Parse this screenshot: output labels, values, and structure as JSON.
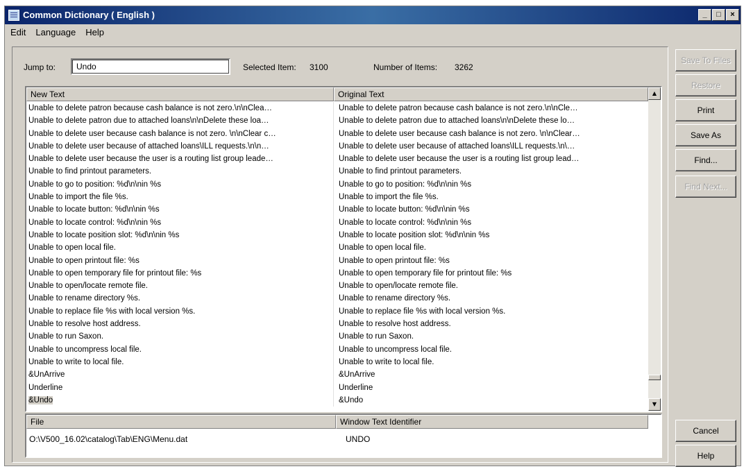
{
  "window": {
    "title": "Common Dictionary  ( English )",
    "controls": {
      "minimize": "_",
      "maximize": "□",
      "close": "×"
    }
  },
  "menu": {
    "items": [
      "Edit",
      "Language",
      "Help"
    ]
  },
  "toolbar": {
    "jump_label": "Jump to:",
    "jump_value": "Undo",
    "selected_item_label": "Selected Item:",
    "selected_item_value": "3100",
    "number_items_label": "Number of Items:",
    "number_items_value": "3262"
  },
  "main_table": {
    "headers": [
      "New Text",
      "Original Text"
    ],
    "rows": [
      [
        "Unable to delete patron because cash balance is not zero.\\n\\nClea…",
        "Unable to delete patron because cash balance is not zero.\\n\\nCle…"
      ],
      [
        "Unable to delete patron due to attached loans\\n\\nDelete these loa…",
        "Unable to delete patron due to attached loans\\n\\nDelete these lo…"
      ],
      [
        "Unable to delete user because cash balance is not zero. \\n\\nClear c…",
        "Unable to delete user because cash balance is not zero. \\n\\nClear…"
      ],
      [
        "Unable to delete user because of attached loans\\ILL requests.\\n\\n…",
        "Unable to delete user because of attached loans\\ILL requests.\\n\\…"
      ],
      [
        "Unable to delete user because the user is a routing list group leade…",
        "Unable to delete user because the user is a routing list group lead…"
      ],
      [
        "Unable to find printout parameters.",
        "Unable to find printout parameters."
      ],
      [
        "Unable to go to position: %d\\n\\nin %s",
        "Unable to go to position: %d\\n\\nin %s"
      ],
      [
        "Unable to import the file %s.",
        "Unable to import the file %s."
      ],
      [
        "Unable to locate button: %d\\n\\nin %s",
        "Unable to locate button: %d\\n\\nin %s"
      ],
      [
        "Unable to locate control: %d\\n\\nin %s",
        "Unable to locate control: %d\\n\\nin %s"
      ],
      [
        "Unable to locate position slot: %d\\n\\nin %s",
        "Unable to locate position slot: %d\\n\\nin %s"
      ],
      [
        "Unable to open local file.",
        "Unable to open local file."
      ],
      [
        "Unable to open printout file: %s",
        "Unable to open printout file: %s"
      ],
      [
        "Unable to open temporary file for printout file: %s",
        "Unable to open temporary file for printout file: %s"
      ],
      [
        "Unable to open/locate remote file.",
        "Unable to open/locate remote file."
      ],
      [
        "Unable to rename directory %s.",
        "Unable to rename directory %s."
      ],
      [
        "Unable to replace file %s with local version %s.",
        "Unable to replace file %s with local version %s."
      ],
      [
        "Unable to resolve host address.",
        "Unable to resolve host address."
      ],
      [
        "Unable to run Saxon.",
        "Unable to run Saxon."
      ],
      [
        "Unable to uncompress local file.",
        "Unable to uncompress local file."
      ],
      [
        "Unable to write to local file.",
        "Unable to write to local file."
      ],
      [
        "&UnArrive",
        "&UnArrive"
      ],
      [
        "Underline",
        "Underline"
      ],
      [
        "&Undo",
        "&Undo"
      ]
    ],
    "selected_row": 23
  },
  "detail_table": {
    "headers": [
      "File",
      "Window Text Identifier"
    ],
    "file": "O:\\V500_16.02\\catalog\\Tab\\ENG\\Menu.dat",
    "identifier": "UNDO"
  },
  "buttons": {
    "save_to_files": "Save To Files",
    "restore": "Restore",
    "print": "Print",
    "save_as": "Save As",
    "find": "Find...",
    "find_next": "Find Next...",
    "cancel": "Cancel",
    "help": "Help"
  }
}
